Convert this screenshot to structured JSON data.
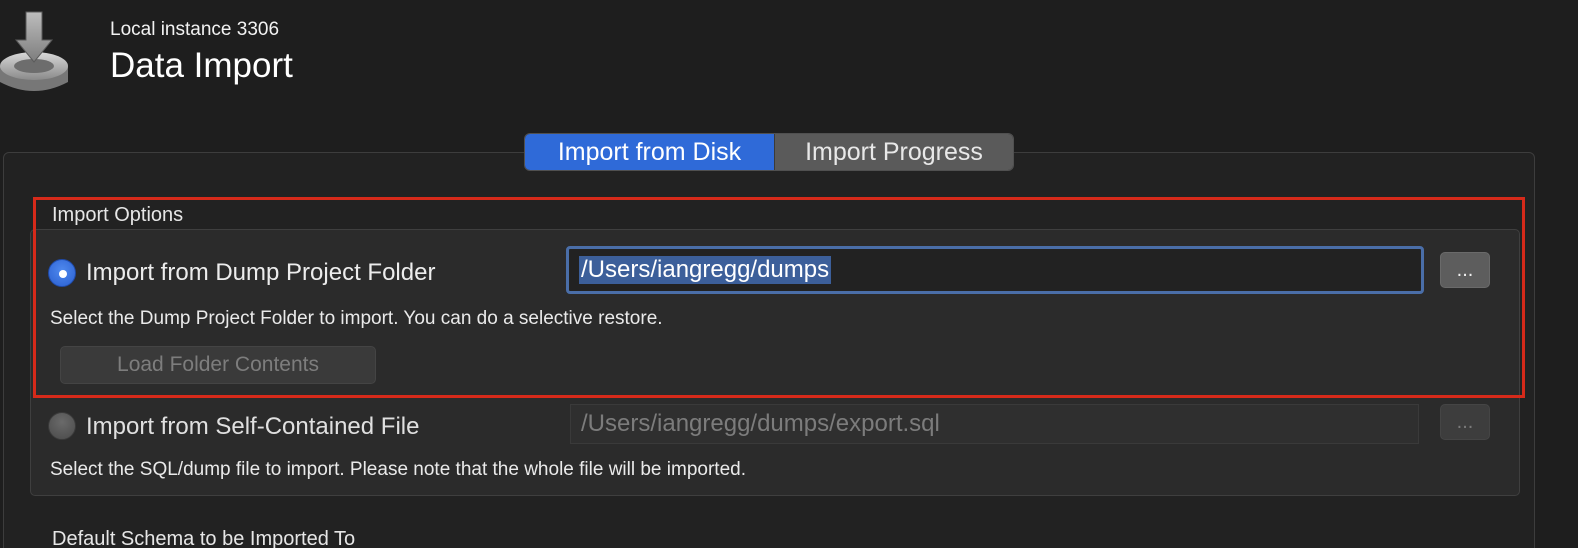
{
  "header": {
    "instance": "Local instance 3306",
    "title": "Data Import",
    "icon": "database-import-icon"
  },
  "tabs": [
    {
      "label": "Import from Disk",
      "active": true
    },
    {
      "label": "Import Progress",
      "active": false
    }
  ],
  "import_options": {
    "title": "Import Options",
    "dump_folder": {
      "label": "Import from Dump Project Folder",
      "selected": true,
      "path": "/Users/iangregg/dumps",
      "browse_label": "...",
      "hint": "Select the Dump Project Folder to import. You can do a selective restore.",
      "load_button": "Load Folder Contents"
    },
    "self_contained": {
      "label": "Import from Self-Contained File",
      "selected": false,
      "path": "/Users/iangregg/dumps/export.sql",
      "browse_label": "...",
      "hint": "Select the SQL/dump file to import. Please note that the whole file will be imported."
    }
  },
  "default_schema": {
    "title": "Default Schema to be Imported To"
  },
  "colors": {
    "accent": "#2f6ad8",
    "highlight": "#d62a1a",
    "background": "#1e1e1e"
  }
}
